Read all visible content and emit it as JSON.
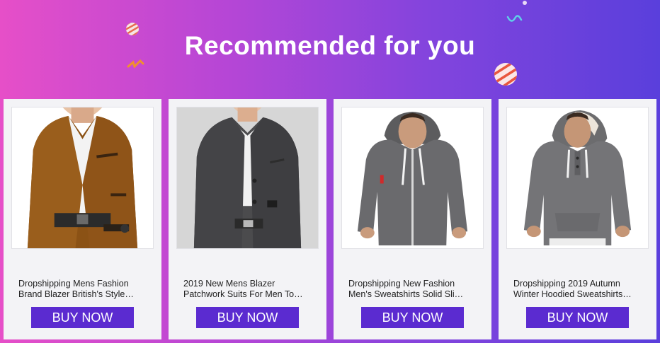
{
  "header": {
    "title": "Recommended for you"
  },
  "colors": {
    "gradient_start": "#e64fc8",
    "gradient_end": "#5a3fdc",
    "card_bg": "#f3f3f6",
    "button_bg": "#5b2bd0",
    "button_text": "#ffffff"
  },
  "products": [
    {
      "image": "brown-corduroy-blazer-photo",
      "title_line1": "Dropshipping Mens Fashion",
      "title_line2": "Brand Blazer British's Style…",
      "button_label": "BUY NOW"
    },
    {
      "image": "grey-patchwork-blazer-photo",
      "title_line1": "2019 New Mens Blazer",
      "title_line2": "Patchwork Suits For Men To…",
      "button_label": "BUY NOW"
    },
    {
      "image": "grey-zip-hoodie-photo",
      "title_line1": "Dropshipping New Fashion",
      "title_line2": "Men's Sweatshirts Solid Sli…",
      "button_label": "BUY NOW"
    },
    {
      "image": "grey-pullover-hoodie-photo",
      "title_line1": "Dropshipping 2019 Autumn",
      "title_line2": "Winter Hoodied Sweatshirts…",
      "button_label": "BUY NOW"
    }
  ]
}
